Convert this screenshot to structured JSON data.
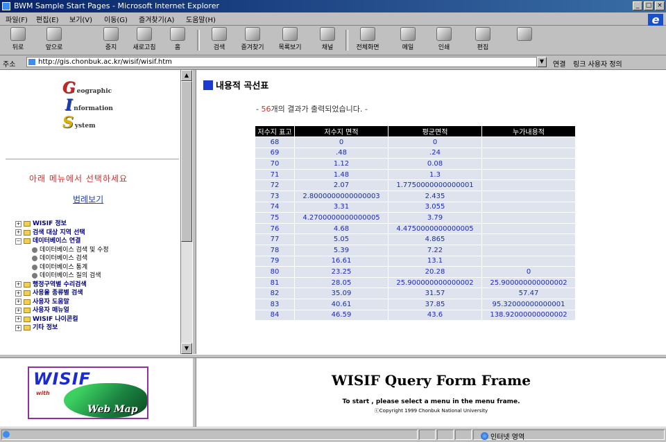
{
  "window": {
    "title": "BWM Sample Start Pages - Microsoft Internet Explorer"
  },
  "menubar": {
    "items": [
      "파일(F)",
      "편집(E)",
      "보기(V)",
      "이동(G)",
      "즐겨찾기(A)",
      "도움말(H)"
    ]
  },
  "toolbar": {
    "buttons": [
      "뒤로",
      "앞으로",
      "중지",
      "새로고침",
      "홈",
      "검색",
      "즐겨찾기",
      "목록보기",
      "채널",
      "전체화면",
      "메일",
      "인쇄",
      "편집"
    ]
  },
  "address": {
    "label": "주소",
    "url": "http://gis.chonbuk.ac.kr/wisif/wisif.htm",
    "go_label": "연결",
    "links_label": "링크 사용자 정의"
  },
  "left_frame": {
    "logo_lines": [
      "eographic",
      "nformation",
      "ystem"
    ],
    "logo_initials": [
      "G",
      "I",
      "S"
    ],
    "menu_prompt": "아래 메뉴에서 선택하세요",
    "view_all": "범례보기",
    "tree": [
      {
        "label": "WISIF 정보",
        "type": "folder"
      },
      {
        "label": "검색 대상 지역 선택",
        "type": "folder"
      },
      {
        "label": "데이터베이스 연결",
        "type": "folder-open"
      },
      {
        "label": "데이터베이스 검색 및 수정",
        "type": "doc"
      },
      {
        "label": "데이터베이스 검색",
        "type": "doc"
      },
      {
        "label": "데이터베이스 통계",
        "type": "doc"
      },
      {
        "label": "데이터베이스 질의 검색",
        "type": "doc"
      },
      {
        "label": "행정구역별 수리검색",
        "type": "folder"
      },
      {
        "label": "사용율 종류별 검색",
        "type": "folder"
      },
      {
        "label": "사용자 도움말",
        "type": "folder"
      },
      {
        "label": "사용자 매뉴얼",
        "type": "folder"
      },
      {
        "label": "WISIF 나이콘컬",
        "type": "folder"
      },
      {
        "label": "기타 정보",
        "type": "folder"
      }
    ]
  },
  "right_frame": {
    "heading": "내용적 곡선표",
    "result_prefix": "- ",
    "result_count": "56",
    "result_suffix": "개의 결과가 출력되었습니다. -",
    "table": {
      "headers": [
        "저수지 표고",
        "저수지 면적",
        "평균면적",
        "누가내용적"
      ],
      "rows": [
        [
          "68",
          "0",
          "0",
          ""
        ],
        [
          "69",
          ".48",
          ".24",
          ""
        ],
        [
          "70",
          "1.12",
          "0.08",
          ""
        ],
        [
          "71",
          "1.48",
          "1.3",
          ""
        ],
        [
          "72",
          "2.07",
          "1.7750000000000001",
          ""
        ],
        [
          "73",
          "2.8000000000000003",
          "2.435",
          ""
        ],
        [
          "74",
          "3.31",
          "3.055",
          ""
        ],
        [
          "75",
          "4.2700000000000005",
          "3.79",
          ""
        ],
        [
          "76",
          "4.68",
          "4.4750000000000005",
          ""
        ],
        [
          "77",
          "5.05",
          "4.865",
          ""
        ],
        [
          "78",
          "5.39",
          "7.22",
          ""
        ],
        [
          "79",
          "16.61",
          "13.1",
          ""
        ],
        [
          "80",
          "23.25",
          "20.28",
          "0"
        ],
        [
          "81",
          "28.05",
          "25.900000000000002",
          "25.900000000000002"
        ],
        [
          "82",
          "35.09",
          "31.57",
          "57.47"
        ],
        [
          "83",
          "40.61",
          "37.85",
          "95.32000000000001"
        ],
        [
          "84",
          "46.59",
          "43.6",
          "138.92000000000002"
        ]
      ]
    }
  },
  "logo_frame": {
    "wisif": "WISIF",
    "with": "with",
    "webmap": "Web Map"
  },
  "query_frame": {
    "title": "WISIF Query Form Frame",
    "instruction": "To start , please select a menu in the menu frame.",
    "copyright": "ⓒCopyright 1999 Chonbuk National University"
  },
  "statusbar": {
    "zone": "인터넷 영역"
  }
}
